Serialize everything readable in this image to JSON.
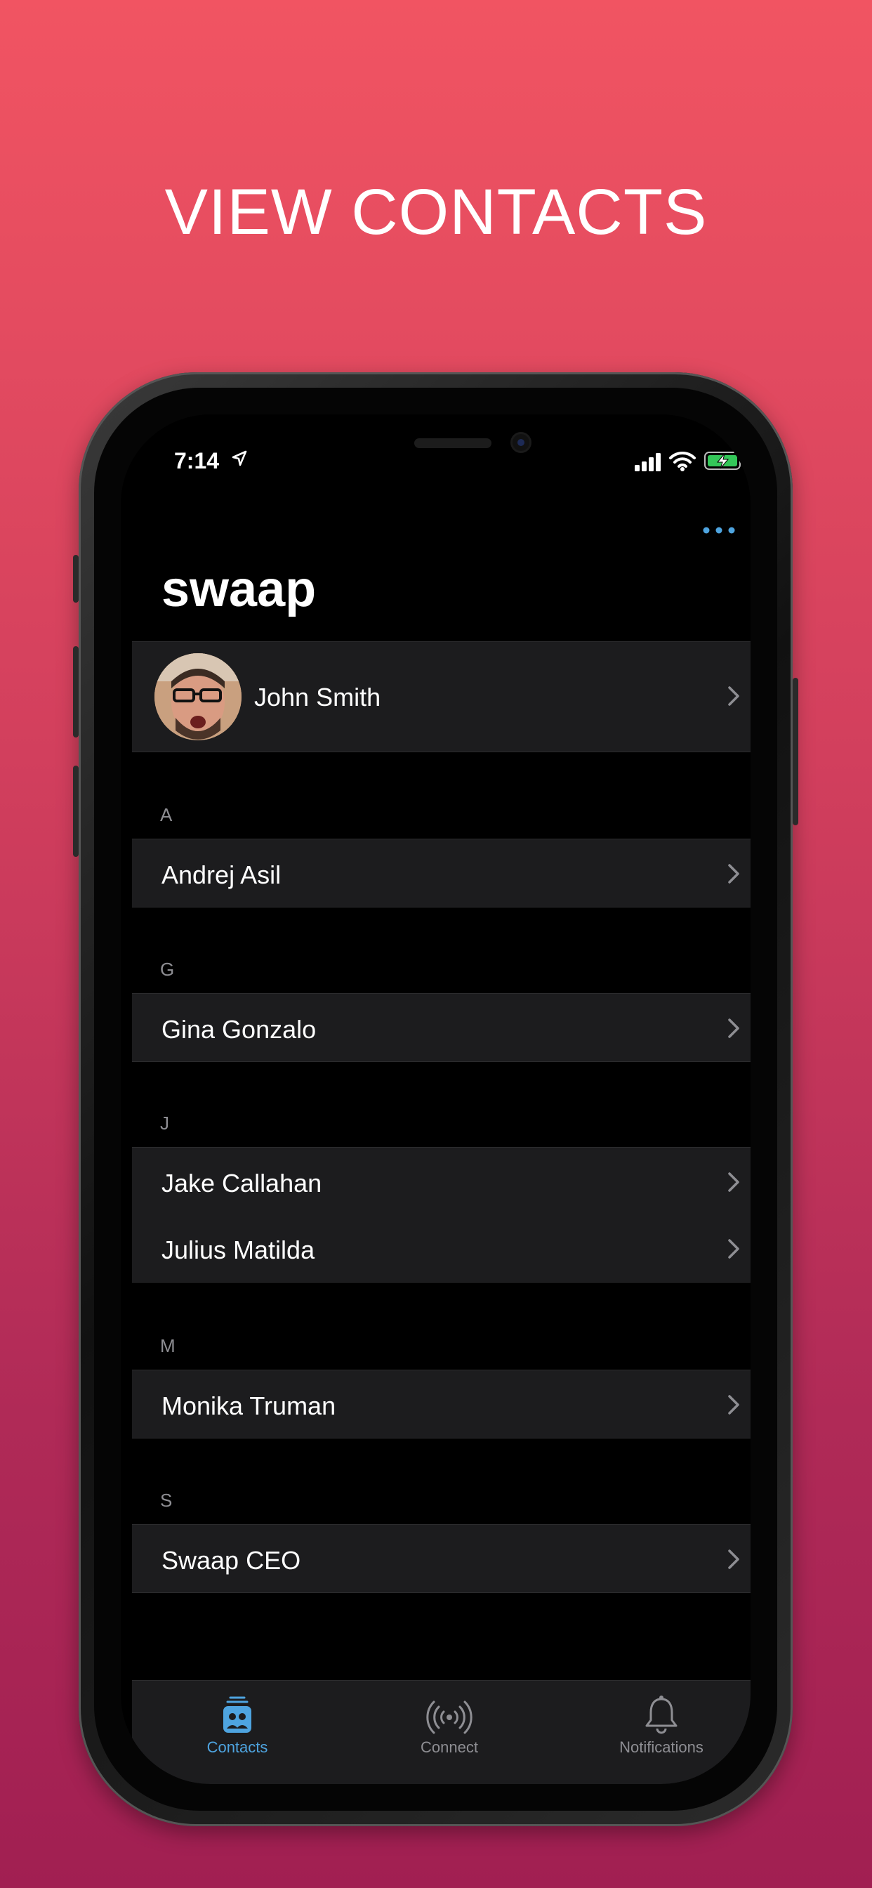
{
  "headline": "VIEW CONTACTS",
  "status_bar": {
    "time": "7:14"
  },
  "app": {
    "title": "swaap",
    "more_icon": "ellipsis-icon",
    "accent": "#4ea4e0"
  },
  "profile": {
    "name": "John Smith"
  },
  "sections": [
    {
      "letter": "A",
      "contacts": [
        "Andrej Asil"
      ]
    },
    {
      "letter": "G",
      "contacts": [
        "Gina Gonzalo"
      ]
    },
    {
      "letter": "J",
      "contacts": [
        "Jake Callahan",
        "Julius Matilda"
      ]
    },
    {
      "letter": "M",
      "contacts": [
        "Monika Truman"
      ]
    },
    {
      "letter": "S",
      "contacts": [
        "Swaap CEO"
      ]
    }
  ],
  "index": [
    "A",
    "G",
    "J",
    "M",
    "S"
  ],
  "tabs": [
    {
      "label": "Contacts",
      "icon": "contacts-icon",
      "active": true
    },
    {
      "label": "Connect",
      "icon": "broadcast-icon",
      "active": false
    },
    {
      "label": "Notifications",
      "icon": "bell-icon",
      "active": false
    }
  ],
  "colors": {
    "gradient_top": "#f15462",
    "gradient_bottom": "#a11f52",
    "row_bg": "#1c1c1e",
    "inactive_tab": "#8e8e93"
  }
}
